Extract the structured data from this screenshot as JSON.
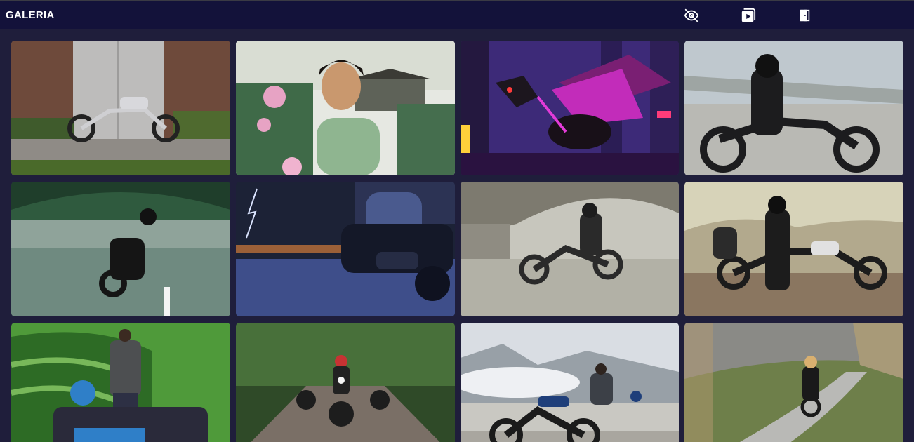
{
  "header": {
    "title": "GALERIA",
    "icons": [
      "eye-off-icon",
      "play-video-icon",
      "exit-door-icon"
    ]
  },
  "colors": {
    "background": "#1f1e3b",
    "header": "#13123a",
    "text": "#ffffff"
  },
  "gallery": {
    "tiles": [
      {
        "subject": "motorcycle-brick-building",
        "sky": "#8a6a55",
        "ground": "#8f8b86",
        "accent": "#cfcfd2"
      },
      {
        "subject": "girl-lotus-pagoda",
        "sky": "#e6e8e2",
        "ground": "#3f6a48",
        "accent": "#e7a3c4"
      },
      {
        "subject": "neon-mecha-dragon",
        "sky": "#3d2a78",
        "ground": "#2a1240",
        "accent": "#e33bd8"
      },
      {
        "subject": "rider-highway-overpass",
        "sky": "#bfc8ce",
        "ground": "#b9b9b4",
        "accent": "#1c1c1e"
      },
      {
        "subject": "rider-graffiti-tunnel",
        "sky": "#2f5a3e",
        "ground": "#6f8a80",
        "accent": "#e8f6ee"
      },
      {
        "subject": "night-ride-lightning",
        "sky": "#1c2236",
        "ground": "#3e4e8a",
        "accent": "#f08a3a"
      },
      {
        "subject": "rider-under-bridge",
        "sky": "#c7c6bd",
        "ground": "#b2b1a6",
        "accent": "#2a2a2a"
      },
      {
        "subject": "riders-desert-hills",
        "sky": "#d7d3b9",
        "ground": "#8a7660",
        "accent": "#1c1c1c"
      },
      {
        "subject": "man-tea-plantation",
        "sky": "#4f9a3a",
        "ground": "#2d6b25",
        "accent": "#2f7fc8"
      },
      {
        "subject": "riders-forest-road",
        "sky": "#2f4a28",
        "ground": "#7a6f66",
        "accent": "#c73333"
      },
      {
        "subject": "rider-mountain-clouds",
        "sky": "#d9dde3",
        "ground": "#a9a69f",
        "accent": "#1f3f7a"
      },
      {
        "subject": "rider-winding-road",
        "sky": "#8a8a86",
        "ground": "#6e7f4a",
        "accent": "#d9b070"
      }
    ]
  }
}
